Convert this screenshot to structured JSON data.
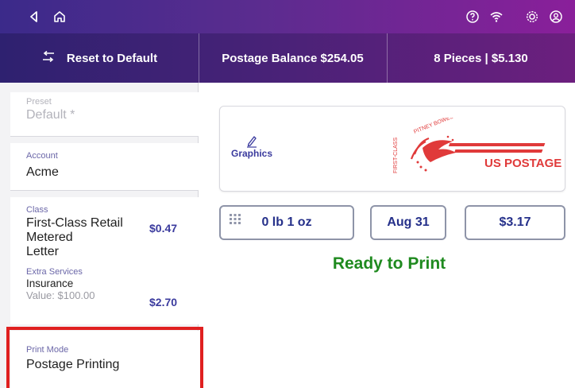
{
  "colors": {
    "accent_purple": "#4a2a8a",
    "ready_green": "#1f8a1f",
    "stamp_red": "#e03a3a",
    "highlight_red": "#e02020"
  },
  "topbar": {
    "icons": [
      "back-icon",
      "home-icon",
      "help-icon",
      "wifi-icon",
      "settings-icon",
      "account-icon"
    ]
  },
  "nav": {
    "reset_label": "Reset to Default",
    "balance_label": "Postage Balance $254.05",
    "pieces_label": "8 Pieces | $5.130"
  },
  "sidebar": {
    "preset": {
      "label": "Preset",
      "value": "Default *"
    },
    "account": {
      "label": "Account",
      "value": "Acme"
    },
    "class": {
      "label": "Class",
      "value_line1": "First-Class Retail",
      "value_line2": "Metered",
      "value_line3": "Letter",
      "price": "$0.47"
    },
    "extra": {
      "label": "Extra Services",
      "name": "Insurance",
      "price": "$2.70",
      "detail": "Value: $100.00"
    },
    "print_mode": {
      "label": "Print Mode",
      "value": "Postage Printing"
    }
  },
  "main": {
    "graphics_label": "Graphics",
    "stamp": {
      "side_text": "FIRST-CLASS",
      "arc_text": "PITNEY BOWES",
      "brand_text": "US POSTAGE"
    },
    "weight": "0 lb 1 oz",
    "date": "Aug 31",
    "amount": "$3.17",
    "status": "Ready to Print"
  }
}
